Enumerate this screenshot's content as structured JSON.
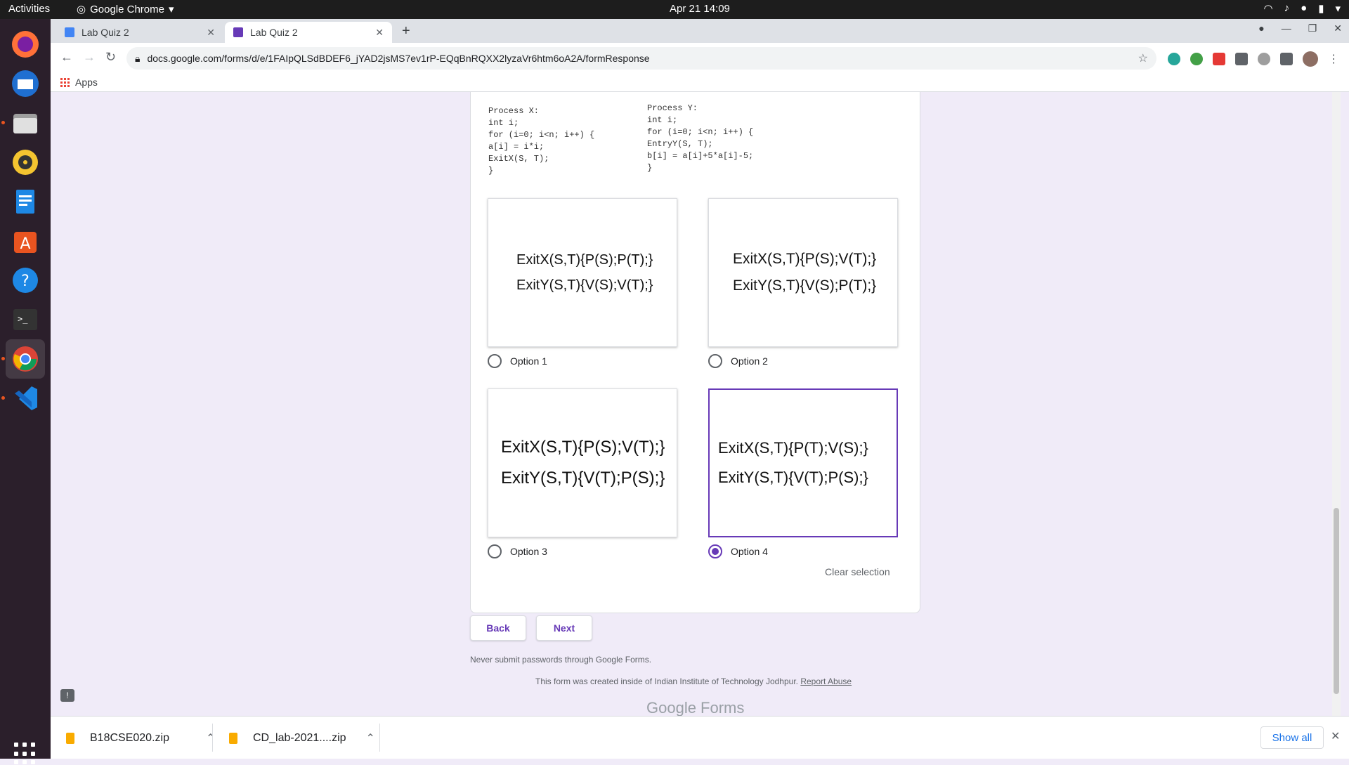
{
  "system": {
    "activities": "Activities",
    "app_name": "Google Chrome",
    "clock": "Apr 21  14:09"
  },
  "browser": {
    "tabs": [
      {
        "title": "Lab Quiz 2"
      },
      {
        "title": "Lab Quiz 2"
      }
    ],
    "url": "docs.google.com/forms/d/e/1FAIpQLSdBDEF6_jYAD2jsMS7ev1rP-EQqBnRQXX2lyzaVr6htm6oA2A/formResponse",
    "bookmarks_apps": "Apps"
  },
  "question": {
    "process_x": "Process X:\nint i;\nfor (i=0; i<n; i++) {\na[i] = i*i;\nExitX(S, T);\n}",
    "process_y": "Process Y:\nint i;\nfor (i=0; i<n; i++) {\nEntryY(S, T);\nb[i] = a[i]+5*a[i]-5;\n}"
  },
  "options": [
    {
      "label": "Option 1",
      "line1": "ExitX(S,T){P(S);P(T);}",
      "line2": "ExitY(S,T){V(S);V(T);}",
      "selected": false
    },
    {
      "label": "Option 2",
      "line1": "ExitX(S,T){P(S);V(T);}",
      "line2": "ExitY(S,T){V(S);P(T);}",
      "selected": false
    },
    {
      "label": "Option 3",
      "line1": "ExitX(S,T){P(S);V(T);}",
      "line2": "ExitY(S,T){V(T);P(S);}",
      "selected": false
    },
    {
      "label": "Option 4",
      "line1": "ExitX(S,T){P(T);V(S);}",
      "line2": "ExitY(S,T){V(T);P(S);}",
      "selected": true
    }
  ],
  "clear_selection": "Clear selection",
  "buttons": {
    "back": "Back",
    "next": "Next"
  },
  "footer": {
    "password_note": "Never submit passwords through Google Forms.",
    "created_note": "This form was created inside of Indian Institute of Technology Jodhpur.",
    "report_abuse": "Report Abuse",
    "logo_text": "Google Forms"
  },
  "downloads": {
    "items": [
      {
        "name": "B18CSE020.zip"
      },
      {
        "name": "CD_lab-2021....zip"
      }
    ],
    "show_all": "Show all"
  },
  "colors": {
    "accent": "#673ab7",
    "page_bg": "#f0ebf8",
    "dock_bg": "#2b1f2b"
  }
}
